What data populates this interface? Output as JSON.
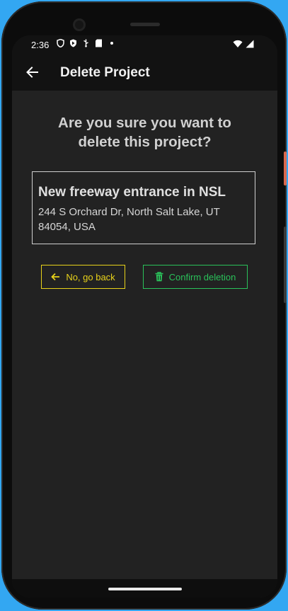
{
  "status_bar": {
    "time": "2:36"
  },
  "app_bar": {
    "title": "Delete Project"
  },
  "dialog": {
    "question": "Are you sure you want to delete this project?",
    "project": {
      "name": "New freeway entrance in NSL",
      "address": "244 S Orchard Dr, North Salt Lake, UT 84054, USA"
    },
    "back_label": "No, go back",
    "confirm_label": "Confirm deletion"
  },
  "colors": {
    "back_accent": "#e8d21a",
    "confirm_accent": "#2ac25a",
    "background": "#222222"
  }
}
